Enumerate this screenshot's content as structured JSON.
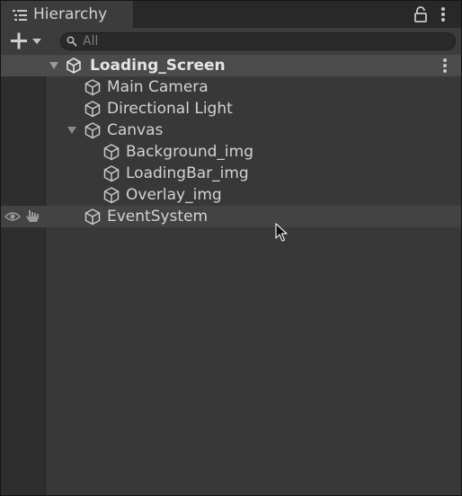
{
  "tab": {
    "title": "Hierarchy",
    "icon": "list-icon"
  },
  "toolbar": {
    "create_icon": "plus-icon",
    "search": {
      "value": "",
      "placeholder": "All"
    }
  },
  "scene": {
    "name": "Loading_Screen",
    "icon": "unity-logo-icon",
    "expanded": true
  },
  "hierarchy": [
    {
      "name": "Main Camera",
      "depth": 1,
      "icon": "gameobject-cube-icon"
    },
    {
      "name": "Directional Light",
      "depth": 1,
      "icon": "gameobject-cube-icon"
    },
    {
      "name": "Canvas",
      "depth": 1,
      "icon": "gameobject-cube-icon",
      "expanded": true
    },
    {
      "name": "Background_img",
      "depth": 2,
      "icon": "gameobject-cube-icon"
    },
    {
      "name": "LoadingBar_img",
      "depth": 2,
      "icon": "gameobject-cube-icon"
    },
    {
      "name": "Overlay_img",
      "depth": 2,
      "icon": "gameobject-cube-icon"
    },
    {
      "name": "EventSystem",
      "depth": 1,
      "icon": "gameobject-cube-icon",
      "hovered": true
    }
  ],
  "colors": {
    "panel_background": "#383838",
    "tab_background": "#3c3c3c",
    "scene_row": "#4b4b4b",
    "hover_row": "#434343",
    "text": "#d2d2d2"
  }
}
